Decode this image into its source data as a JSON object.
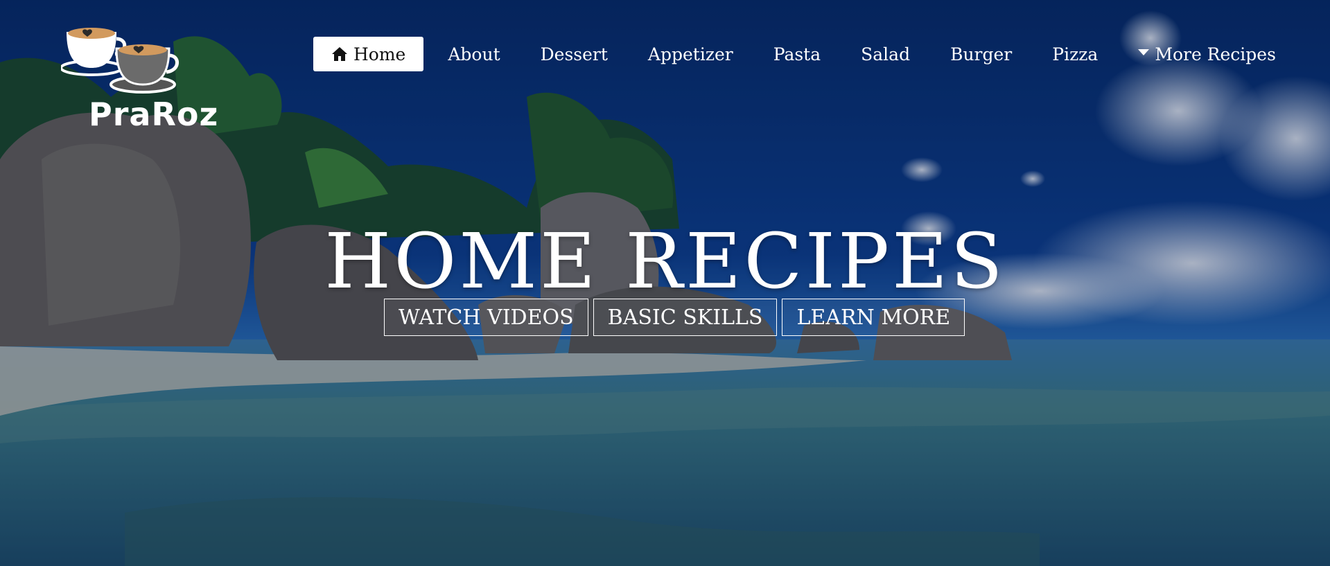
{
  "brand": {
    "name": "PraRoz"
  },
  "nav": {
    "items": [
      {
        "label": "Home",
        "icon": "home-icon",
        "active": true
      },
      {
        "label": "About"
      },
      {
        "label": "Dessert"
      },
      {
        "label": "Appetizer"
      },
      {
        "label": "Pasta"
      },
      {
        "label": "Salad"
      },
      {
        "label": "Burger"
      },
      {
        "label": "Pizza"
      },
      {
        "label": "More Recipes",
        "icon": "caret-down-icon"
      }
    ]
  },
  "hero": {
    "title": "HOME RECIPES",
    "buttons": [
      {
        "label": "WATCH VIDEOS"
      },
      {
        "label": "BASIC SKILLS"
      },
      {
        "label": "LEARN MORE"
      }
    ]
  },
  "colors": {
    "sky": "#0a2f6e",
    "nav_active_bg": "#ffffff",
    "text": "#ffffff"
  }
}
